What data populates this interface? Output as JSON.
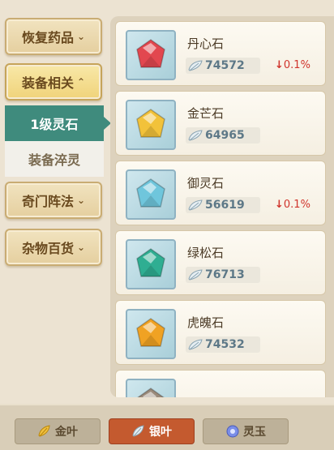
{
  "sidebar": {
    "categories": [
      {
        "label": "恢复药品",
        "chevron": "chevron-down-icon"
      },
      {
        "label": "装备相关",
        "chevron": "chevron-up-icon"
      },
      {
        "label": "奇门阵法",
        "chevron": "chevron-down-icon"
      },
      {
        "label": "杂物百货",
        "chevron": "chevron-down-icon"
      }
    ],
    "subitems": [
      {
        "label": "1级灵石",
        "selected": true
      },
      {
        "label": "装备淬灵",
        "selected": false
      }
    ]
  },
  "items": [
    {
      "name": "丹心石",
      "price": "74572",
      "change": "0.1%",
      "change_dir": "down",
      "gem_color": "#e2474f"
    },
    {
      "name": "金芒石",
      "price": "64965",
      "change": "",
      "gem_color": "#f2c23a"
    },
    {
      "name": "御灵石",
      "price": "56619",
      "change": "0.1%",
      "change_dir": "down",
      "gem_color": "#6fc6dc"
    },
    {
      "name": "绿松石",
      "price": "76713",
      "change": "",
      "gem_color": "#2fae92"
    },
    {
      "name": "虎魄石",
      "price": "74532",
      "change": "",
      "gem_color": "#f0a223"
    },
    {
      "name": "",
      "price": "",
      "change": "",
      "gem_color": "#9a8a7a"
    }
  ],
  "currency_tabs": [
    {
      "label": "金叶",
      "icon": "gold-leaf-icon",
      "active": false
    },
    {
      "label": "银叶",
      "icon": "silver-leaf-icon",
      "active": true
    },
    {
      "label": "灵玉",
      "icon": "spirit-jade-icon",
      "active": false
    }
  ],
  "colors": {
    "accent_teal": "#3f8b7d",
    "active_tab": "#c45a2f",
    "price_down": "#d0342c"
  }
}
